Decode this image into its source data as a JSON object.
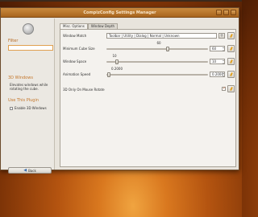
{
  "window": {
    "title": "CompizConfig Settings Manager"
  },
  "sidebar": {
    "filter_label": "Filter",
    "plugin_name": "3D Windows",
    "plugin_description": "Elevates windows while rotating the cube.",
    "use_heading": "Use This Plugin",
    "enable_label": "Enable 3D Windows",
    "enable_checked": false,
    "back_label": "Back"
  },
  "tabs": [
    {
      "label": "Misc. Options",
      "active": true
    },
    {
      "label": "Window Depth",
      "active": false
    }
  ],
  "settings": {
    "window_match": {
      "label": "Window Match",
      "value": "Toolbar | Utility | Dialog | Normal | Unknown"
    },
    "minimum_cube_size": {
      "label": "Minimum Cube Size",
      "value": "60",
      "fraction": 0.6
    },
    "window_space": {
      "label": "Window Space",
      "value": "10",
      "fraction": 0.1
    },
    "animation_speed": {
      "label": "Animation Speed",
      "value": "0.2000",
      "fraction": 0.02
    },
    "only_normal_rotate": {
      "label": "3D Only On Mouse Rotate",
      "checked": true
    }
  },
  "icons": {
    "reset": "reset-icon",
    "add": "plus-icon",
    "back": "back-arrow-icon"
  },
  "colors": {
    "accent": "#c4762a",
    "titlebar": "#b8762e"
  }
}
